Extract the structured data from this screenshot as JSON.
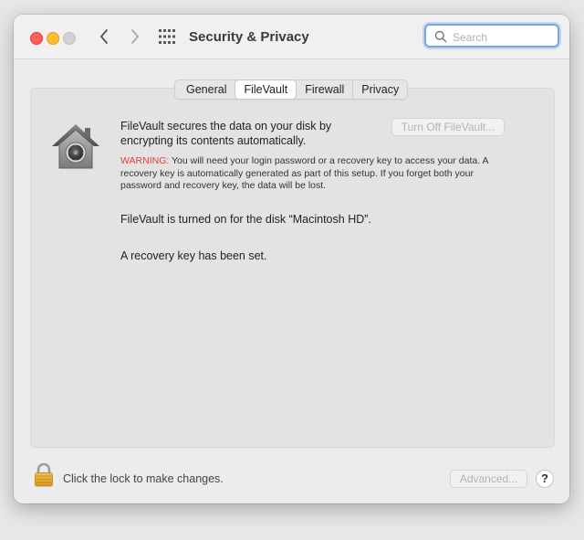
{
  "window": {
    "title": "Security & Privacy",
    "search": {
      "value": "",
      "placeholder": "Search"
    }
  },
  "tabs": [
    {
      "label": "General",
      "active": false
    },
    {
      "label": "FileVault",
      "active": true
    },
    {
      "label": "Firewall",
      "active": false
    },
    {
      "label": "Privacy",
      "active": false
    }
  ],
  "filevault": {
    "description": "FileVault secures the data on your disk by encrypting its contents automatically.",
    "turn_off_button": "Turn Off FileVault...",
    "warning_label": "WARNING:",
    "warning_text": "You will need your login password or a recovery key to access your data. A recovery key is automatically generated as part of this setup. If you forget both your password and recovery key, the data will be lost.",
    "status_disk": "FileVault is turned on for the disk “Macintosh HD”.",
    "status_recovery": "A recovery key has been set."
  },
  "footer": {
    "lock_text": "Click the lock to make changes.",
    "advanced_button": "Advanced...",
    "help_label": "?"
  },
  "icons": {
    "close": "close-icon",
    "minimize": "minimize-icon",
    "zoom": "zoom-icon",
    "back": "chevron-left-icon",
    "forward": "chevron-right-icon",
    "grid": "grid-icon",
    "search": "search-icon",
    "filevault": "filevault-house-icon",
    "lock": "lock-icon"
  }
}
